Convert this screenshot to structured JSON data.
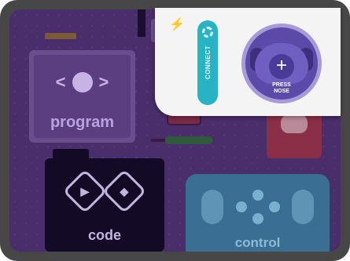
{
  "cards": {
    "program_label": "program",
    "program_icon_left": "<",
    "program_icon_right": ">",
    "code_label": "code",
    "control_label": "control"
  },
  "overlay": {
    "connect_label": "CONNECT",
    "nose_symbol": "+",
    "press_line1": "PRESS",
    "press_line2": "NOSE",
    "lightning_symbol": "⚡"
  },
  "icons": {
    "connect": "connect-icon",
    "nose": "plus-icon",
    "lightning": "lightning-icon"
  },
  "colors": {
    "accent_teal": "#27b3c3",
    "device_purple": "#5b4aa7",
    "background_purple": "#4a2d6b"
  }
}
